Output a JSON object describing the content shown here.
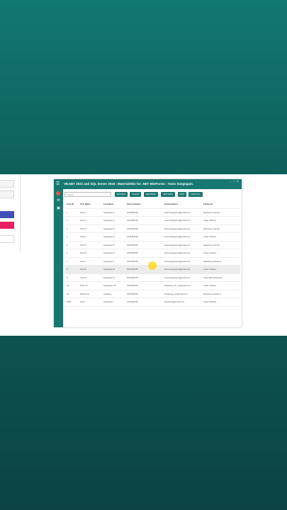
{
  "window": {
    "title": "VB.NET 2021 and SQL Server 2019 : MaterialSkin for .NET WinForms : Tanin Sangngam.",
    "menu_icon": "hamburger-icon",
    "controls": [
      "–",
      "□",
      "✕"
    ]
  },
  "sidebar": {
    "icons": [
      "home-icon",
      "mail-icon",
      "settings-icon"
    ]
  },
  "toolbar": {
    "search_placeholder": "Search",
    "buttons": [
      "SEARCH",
      "CLEAR",
      "REFRESH",
      "ADD NEW",
      "EDIT",
      "VIEW ALL"
    ]
  },
  "table": {
    "columns": [
      "Auto ID",
      "First Name",
      "Last Name",
      "Phone Number",
      "Email Address",
      "Facebook"
    ],
    "rows": [
      [
        "1",
        "Tanin 1",
        "Sangngam 1",
        "0123456789",
        "taninsangngam1@gmail.com",
        "Ibasskung Tutorial"
      ],
      [
        "2",
        "Tanin 2",
        "Sangngam 2",
        "0123456789",
        "taninsangngam1@gmail.com",
        "Coder Afrikora"
      ],
      [
        "3",
        "Tanin 3",
        "Sangngam 3",
        "0123456789",
        "taninsangngam1@gmail.com",
        "Ibasskung Tutorial"
      ],
      [
        "4",
        "Tanin 4",
        "Sangngam 4",
        "0123456789",
        "taninsangngam1@gmail.com",
        "Coder Afrikora"
      ],
      [
        "5",
        "Tanin 5",
        "Sangngam 5",
        "0123456789",
        "taninsangngam1@gmail.com",
        "Ibasskung Tutorial"
      ],
      [
        "6",
        "Tanin 6",
        "Sangngam 6",
        "0123456789",
        "taninsangngam1@gmail.com",
        "Coder Afrikora"
      ],
      [
        "7",
        "Tanin 7",
        "Sangngam 7",
        "0123456789",
        "taninsangngam1@gmail.com",
        "Ibasskung Academy"
      ],
      [
        "8",
        "Tanin 8",
        "Sangngam 8",
        "0123456789",
        "taninsangngam1@gmail.com",
        "Coder Afrikora"
      ],
      [
        "9",
        "Tanin 9",
        "Sangngam 9",
        "0123456789",
        "taninsangngam1@gmail.com",
        "Code With Ibasskung"
      ],
      [
        "40",
        "Tanin 10",
        "Sangngam 10",
        "0123456789",
        "ibasskung_ch_m@gmail.com",
        "Coder Afrikora"
      ],
      [
        "66",
        "Ibasskung",
        "Academy",
        "0123456789",
        "ibasskung_ac@gmail.com",
        "Ibasskung Academy"
      ],
      [
        "1083",
        "Tanin",
        "Sangngam",
        "0123456789",
        "ibasskung@email.com",
        "Coder Afrikora"
      ]
    ],
    "highlighted_row": 7
  },
  "colors": {
    "primary": "#177872",
    "accent_blue": "#3f51b5",
    "accent_pink": "#e91e63"
  }
}
